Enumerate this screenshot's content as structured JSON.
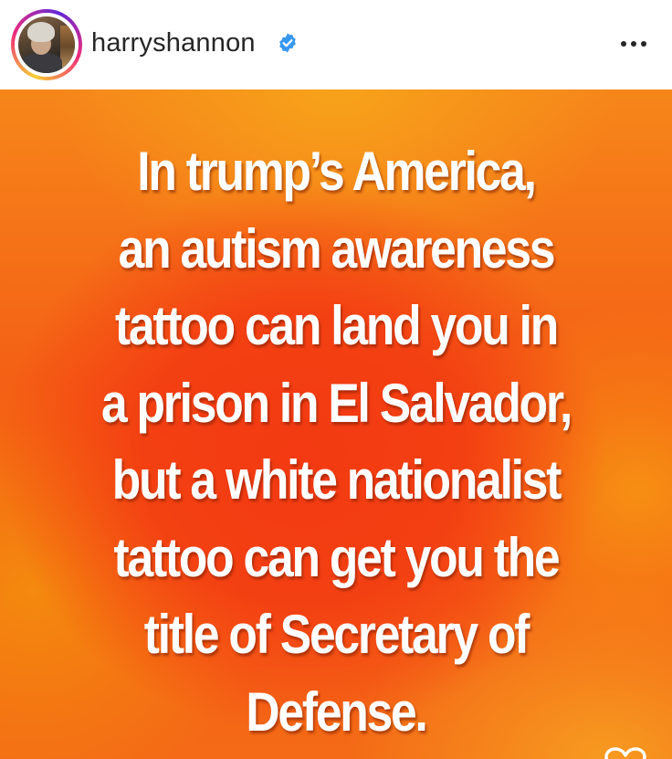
{
  "post": {
    "username": "harryshannon",
    "verified": true,
    "icons": {
      "verified": "verified-badge-icon",
      "more": "more-options-icon",
      "like": "heart-icon"
    },
    "quote_lines": [
      "In trump’s America,",
      "an autism awareness",
      "tattoo can land you in",
      "a prison in El Salvador,",
      "but a white nationalist",
      "tattoo can get you the",
      "title of Secretary of",
      "Defense."
    ]
  },
  "colors": {
    "verified_badge": "#3897f0",
    "background_center": "#f33a12",
    "background_edge": "#f6861a",
    "text": "#ffffff"
  }
}
